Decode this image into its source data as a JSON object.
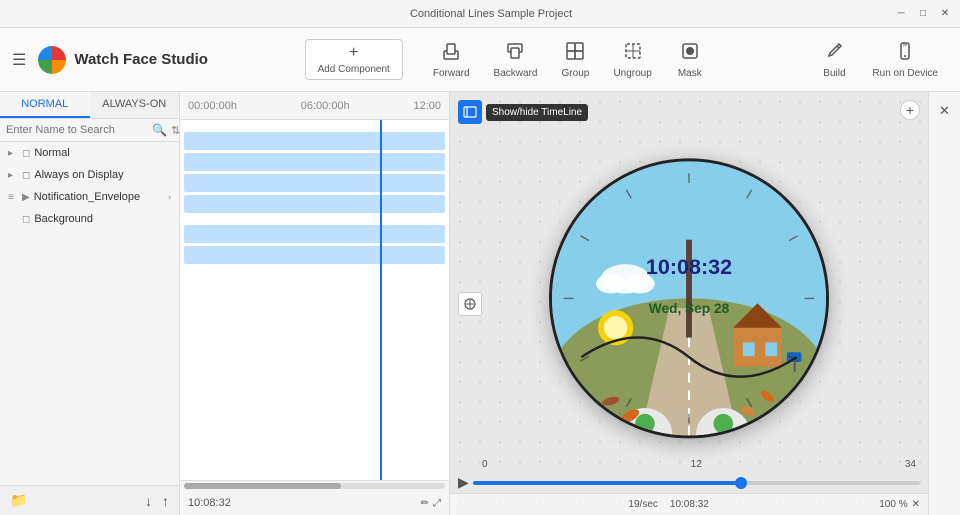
{
  "titleBar": {
    "title": "Conditional Lines Sample Project",
    "controls": [
      "minimize",
      "maximize",
      "close"
    ]
  },
  "header": {
    "hamburger": "☰",
    "appTitle": "Watch Face Studio",
    "addComponent": {
      "label": "Add Component",
      "icon": "+"
    },
    "toolbar": [
      {
        "id": "forward",
        "label": "Forward",
        "icon": "⬆"
      },
      {
        "id": "backward",
        "label": "Backward",
        "icon": "⬇"
      },
      {
        "id": "group",
        "label": "Group",
        "icon": "▦"
      },
      {
        "id": "ungroup",
        "label": "Ungroup",
        "icon": "▤"
      },
      {
        "id": "mask",
        "label": "Mask",
        "icon": "⬜"
      }
    ],
    "toolbarRight": [
      {
        "id": "build",
        "label": "Build",
        "icon": "🔧"
      },
      {
        "id": "run-on-device",
        "label": "Run on Device",
        "icon": "📱"
      }
    ]
  },
  "leftPanel": {
    "tabs": [
      {
        "id": "normal",
        "label": "NORMAL",
        "active": true
      },
      {
        "id": "always-on",
        "label": "ALWAYS-ON",
        "active": false
      }
    ],
    "searchPlaceholder": "Enter Name to Search",
    "layers": [
      {
        "id": "normal-group",
        "name": "Normal",
        "type": "group",
        "indent": 0,
        "expanded": true
      },
      {
        "id": "always-on-group",
        "name": "Always on Display",
        "type": "group",
        "indent": 0,
        "expanded": false
      },
      {
        "id": "notification-envelope",
        "name": "Notification_Envelope",
        "type": "animation",
        "indent": 0,
        "expanded": true,
        "hasArrow": true
      },
      {
        "id": "background",
        "name": "Background",
        "type": "layer",
        "indent": 0,
        "expanded": false
      }
    ],
    "bottomIcons": {
      "folder": "📁",
      "down": "↓",
      "up": "↑"
    }
  },
  "timeline": {
    "markers": [
      "00:00:00h",
      "06:00:00h",
      "12:00"
    ],
    "playhead": "200px",
    "currentTime": "10:08:32",
    "scrollbar": {
      "position": 0,
      "width": "60%"
    },
    "tracks": [
      {
        "id": "track1",
        "width": "100%",
        "color": "#b3d9ff"
      },
      {
        "id": "track2",
        "width": "100%",
        "color": "#b3d9ff"
      },
      {
        "id": "track3",
        "width": "100%",
        "color": "#b3d9ff"
      },
      {
        "id": "track4",
        "width": "100%",
        "color": "#b3d9ff"
      },
      {
        "id": "track5",
        "width": "100%",
        "color": "#b3d9ff"
      },
      {
        "id": "track6",
        "width": "100%",
        "color": "#b3d9ff"
      }
    ]
  },
  "canvas": {
    "showHideTooltip": "Show/hide TimeLine",
    "watchFaceTime": "10:08:32",
    "watchFaceDate": "Wed, Sep 28",
    "progressLabels": [
      "0",
      "12",
      "34"
    ],
    "progressHandle": "60%",
    "currentTime": "10:08:32",
    "fps": "19/sec",
    "zoom": "100 %",
    "playIcon": "▶"
  },
  "rightPanel": {
    "icon": "✕"
  }
}
